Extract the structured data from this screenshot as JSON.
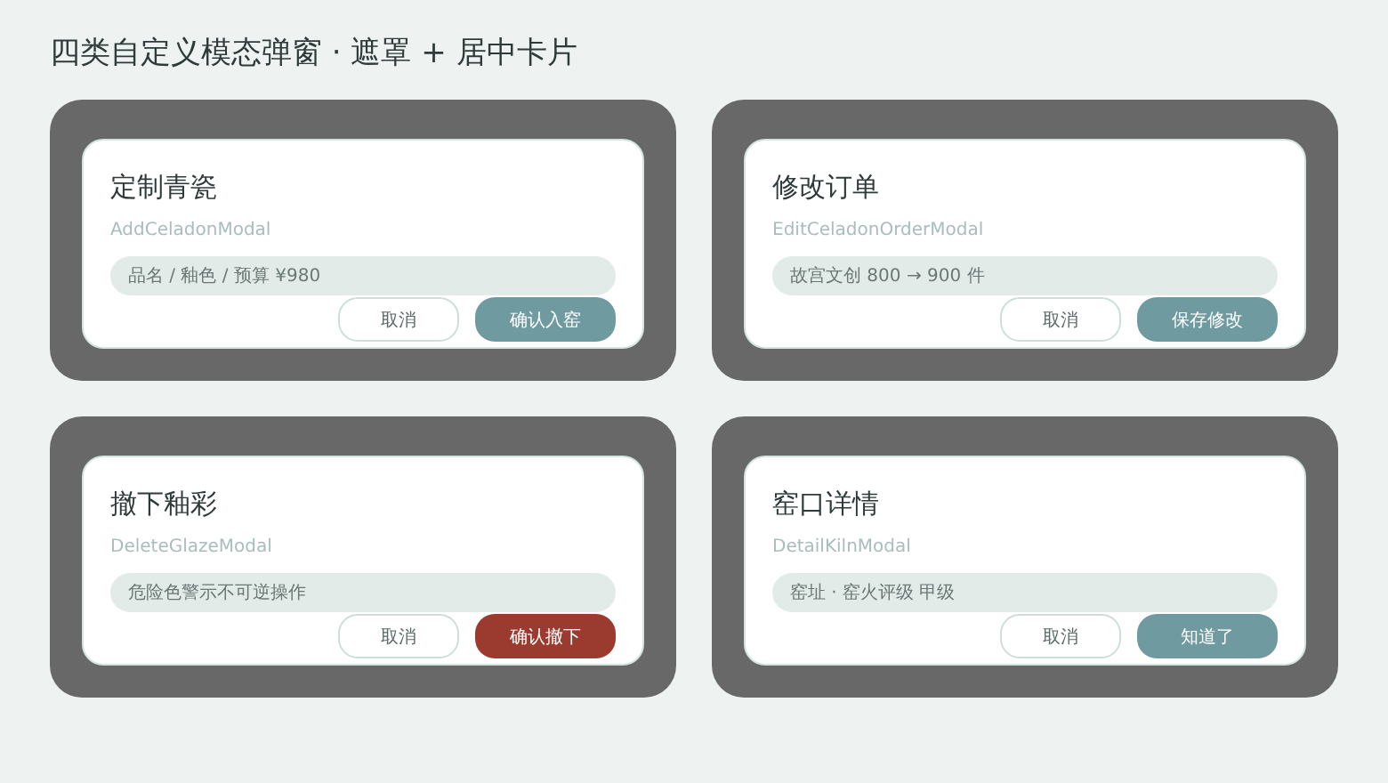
{
  "page_title": "四类自定义模态弹窗 · 遮罩 + 居中卡片",
  "modals": [
    {
      "title": "定制青瓷",
      "component": "AddCeladonModal",
      "placeholder": "品名 / 釉色 / 预算 ¥980",
      "cancel": "取消",
      "confirm": "确认入窑",
      "kind": "primary"
    },
    {
      "title": "修改订单",
      "component": "EditCeladonOrderModal",
      "placeholder": "故宫文创 800 → 900 件",
      "cancel": "取消",
      "confirm": "保存修改",
      "kind": "primary"
    },
    {
      "title": "撤下釉彩",
      "component": "DeleteGlazeModal",
      "placeholder": "危险色警示不可逆操作",
      "cancel": "取消",
      "confirm": "确认撤下",
      "kind": "danger"
    },
    {
      "title": "窑口详情",
      "component": "DetailKilnModal",
      "placeholder": "窑址 · 窑火评级 甲级",
      "cancel": "取消",
      "confirm": "知道了",
      "kind": "primary"
    }
  ]
}
